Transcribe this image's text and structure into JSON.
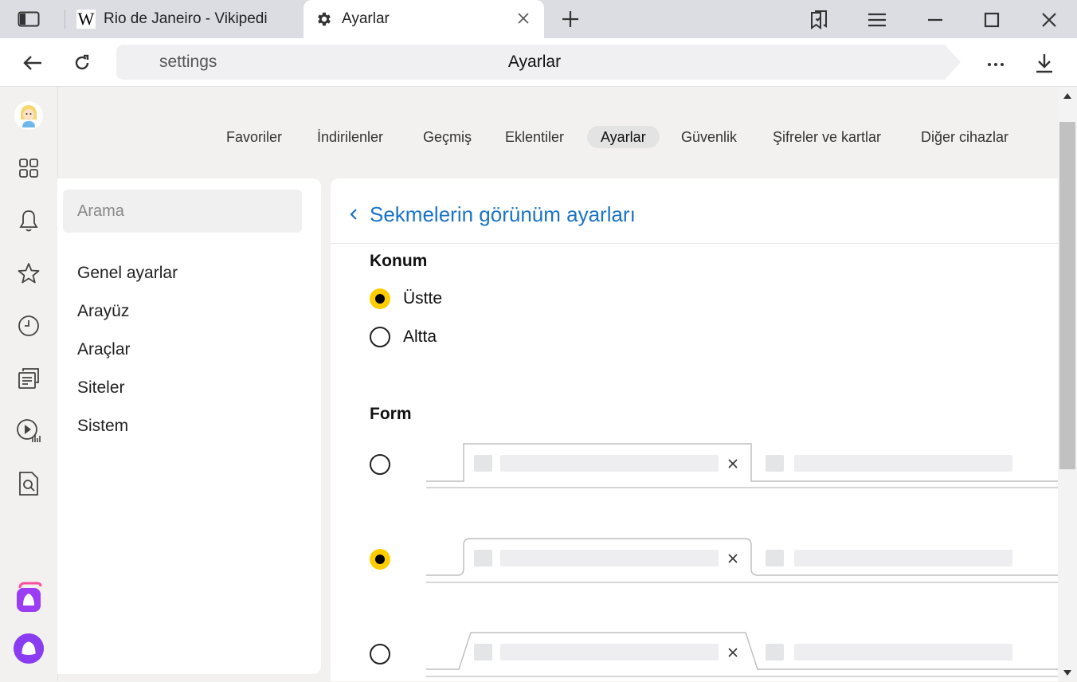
{
  "tabs": [
    {
      "title": "Rio de Janeiro - Vikipedi",
      "favicon": "W"
    },
    {
      "title": "Ayarlar"
    }
  ],
  "address": {
    "host": "settings",
    "title": "Ayarlar"
  },
  "nav": {
    "items": [
      "Favoriler",
      "İndirilenler",
      "Geçmiş",
      "Eklentiler",
      "Ayarlar",
      "Güvenlik",
      "Şifreler ve kartlar",
      "Diğer cihazlar"
    ],
    "active": "Ayarlar"
  },
  "settings_menu": {
    "search_placeholder": "Arama",
    "items": [
      "Genel ayarlar",
      "Arayüz",
      "Araçlar",
      "Siteler",
      "Sistem"
    ]
  },
  "page": {
    "back_title": "Sekmelerin görünüm ayarları",
    "position": {
      "title": "Konum",
      "options": [
        {
          "label": "Üstte",
          "selected": true
        },
        {
          "label": "Altta",
          "selected": false
        }
      ]
    },
    "shape": {
      "title": "Form",
      "options": [
        {
          "style": "rectangular",
          "selected": false
        },
        {
          "style": "rounded",
          "selected": true
        },
        {
          "style": "trapezoid",
          "selected": false
        }
      ]
    }
  },
  "colors": {
    "accent": "#ffcc00",
    "link": "#1a73c8",
    "alice": "#8a3cf0"
  },
  "icons": [
    "sidebar-toggle-icon",
    "gear-icon",
    "plus-icon",
    "bookmarks-icon",
    "menu-icon",
    "minimize-icon",
    "maximize-icon",
    "close-icon",
    "back-icon",
    "reload-icon",
    "more-icon",
    "download-icon",
    "grid-icon",
    "bell-icon",
    "star-icon",
    "clock-icon",
    "notes-icon",
    "video-icon",
    "search-doc-icon",
    "alice-icon"
  ]
}
